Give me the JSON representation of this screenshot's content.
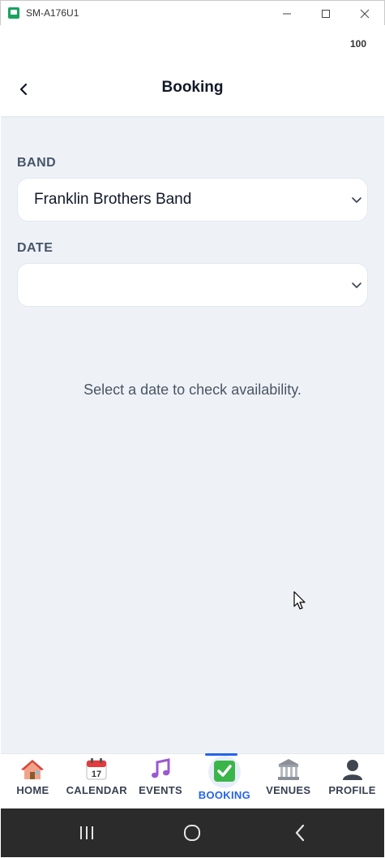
{
  "window": {
    "title": "SM-A176U1",
    "minimize_glyph": "─",
    "maximize_glyph": "☐",
    "close_glyph": "✕"
  },
  "status": {
    "battery": "100"
  },
  "header": {
    "back_glyph": "‹",
    "title": "Booking"
  },
  "form": {
    "band_label": "BAND",
    "band_value": "Franklin Brothers Band",
    "date_label": "DATE",
    "date_value": ""
  },
  "hint": "Select a date to check availability.",
  "tabs": [
    {
      "label": "HOME",
      "icon": "house-icon"
    },
    {
      "label": "CALENDAR",
      "icon": "calendar-icon",
      "icon_text": "17"
    },
    {
      "label": "EVENTS",
      "icon": "music-note-icon"
    },
    {
      "label": "BOOKING",
      "icon": "check-box-icon",
      "active": true
    },
    {
      "label": "VENUES",
      "icon": "building-icon"
    },
    {
      "label": "PROFILE",
      "icon": "person-icon"
    }
  ],
  "colors": {
    "accent": "#2563eb",
    "background": "#eef2f7",
    "nav_bar": "#2b2b2b"
  }
}
